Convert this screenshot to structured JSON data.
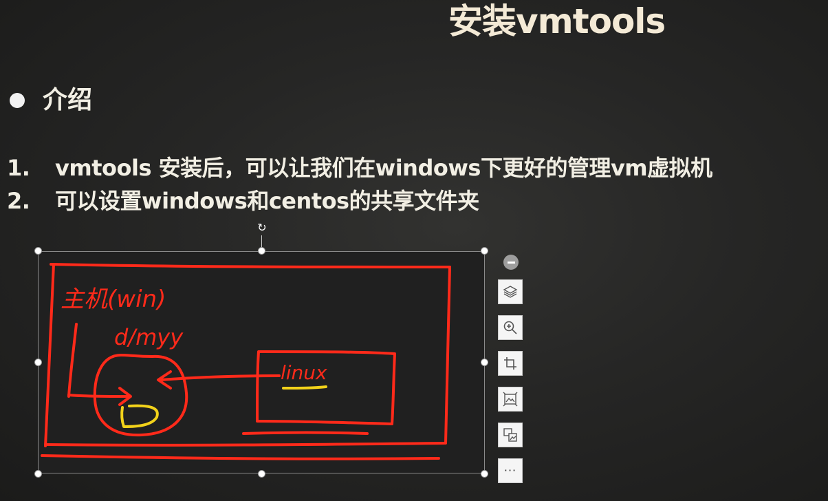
{
  "slide": {
    "title": "安装vmtools",
    "heading": "介绍",
    "items": [
      {
        "num": "1.",
        "text": "vmtools 安装后，可以让我们在windows下更好的管理vm虚拟机"
      },
      {
        "num": "2.",
        "text": "可以设置windows和centos的共享文件夹"
      }
    ]
  },
  "sketch": {
    "host_label": "主机(win)",
    "dir_label": "d/myy",
    "guest_label": "linux"
  },
  "toolbar": {
    "more_label": "···",
    "buttons": [
      "layers-icon",
      "zoom-in-icon",
      "crop-icon",
      "picture-fit-icon",
      "picture-replace-icon",
      "more-options-icon"
    ]
  },
  "colors": {
    "background": "#262625",
    "text": "#f2efe4",
    "ink_red": "#ff2a1a",
    "ink_yellow": "#f2d21a"
  }
}
